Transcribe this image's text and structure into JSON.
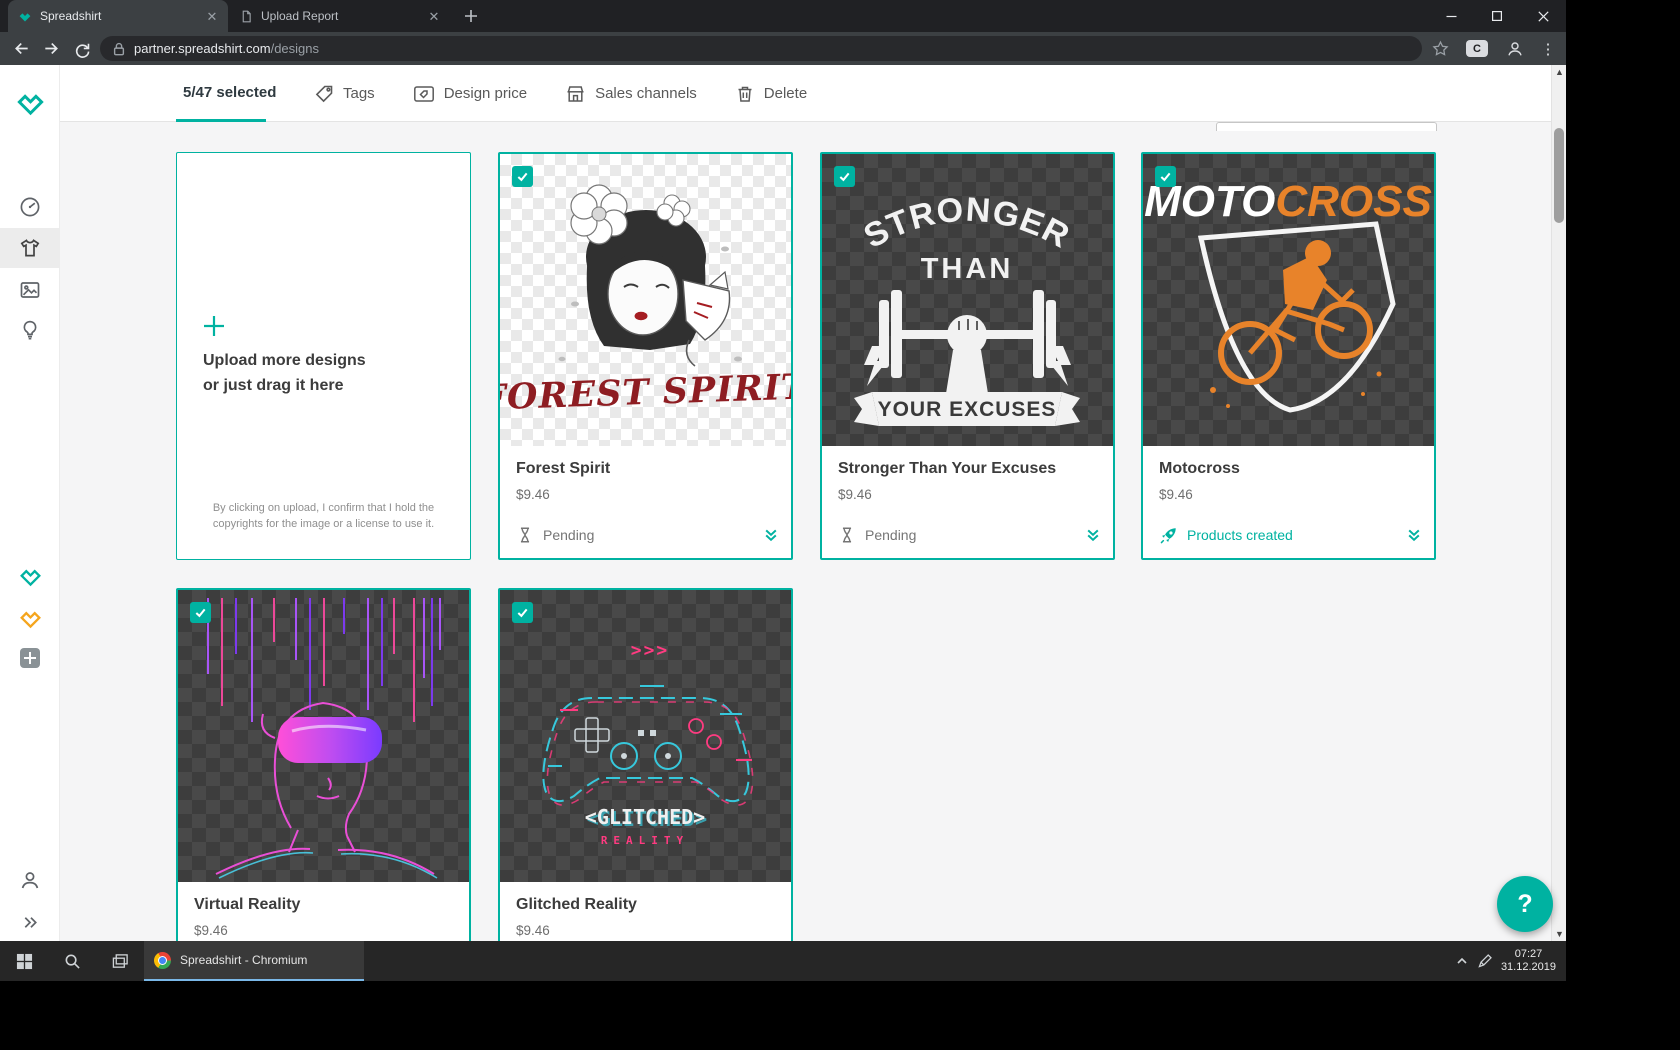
{
  "browser": {
    "tabs": [
      {
        "title": "Spreadshirt"
      },
      {
        "title": "Upload Report"
      }
    ],
    "url_host": "partner.spreadshirt.com",
    "url_path": "/designs",
    "profile_badge": "C"
  },
  "toolbar": {
    "selection": "5/47 selected",
    "actions": [
      "Tags",
      "Design price",
      "Sales channels",
      "Delete"
    ]
  },
  "upload": {
    "line1": "Upload more designs",
    "line2": "or just drag it here",
    "disclaimer1": "By clicking on upload, I confirm that I hold the",
    "disclaimer2": "copyrights for the image or a license to use it."
  },
  "cards": [
    {
      "title": "Forest Spirit",
      "price": "$9.46",
      "status": "Pending"
    },
    {
      "title": "Stronger Than Your Excuses",
      "price": "$9.46",
      "status": "Pending"
    },
    {
      "title": "Motocross",
      "price": "$9.46",
      "status": "Products created"
    },
    {
      "title": "Virtual Reality",
      "price": "$9.46"
    },
    {
      "title": "Glitched Reality",
      "price": "$9.46"
    }
  ],
  "art": {
    "forest_spirit_text": "FOREST SPIRIT",
    "stronger_line1": "STRONGER",
    "stronger_line2": "THAN",
    "stronger_banner": "YOUR EXCUSES",
    "moto_text1": "MOTO",
    "moto_text2": "CROSS",
    "glitch_arrows": ">>>",
    "glitch_text1": "<GLITCHED>",
    "glitch_text2": "REALITY"
  },
  "fab": {
    "label": "?"
  },
  "taskbar": {
    "app_label": "Spreadshirt - Chromium",
    "time": "07:27",
    "date": "31.12.2019"
  },
  "colors": {
    "accent_teal": "#00b2a1",
    "brand_orange": "#f5a51d",
    "moto_orange": "#e8832a",
    "glitch_pink": "#ff3b81",
    "glitch_cyan": "#37c8dc"
  }
}
